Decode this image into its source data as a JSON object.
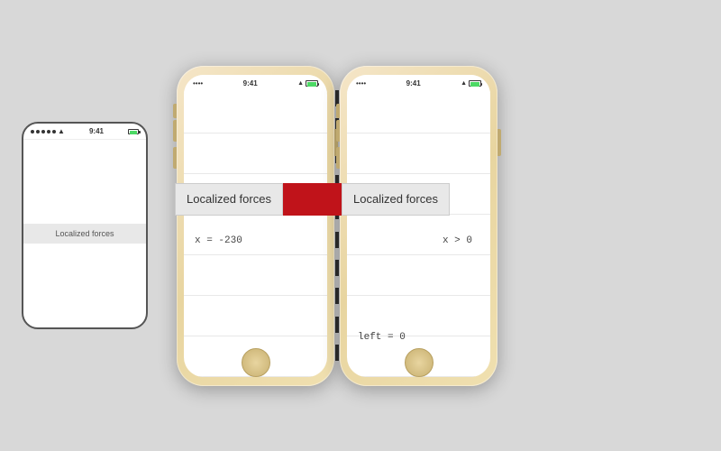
{
  "background": "#d8d8d8",
  "wireframe_phone": {
    "status_time": "9:41",
    "label": "Localized forces"
  },
  "phone_left": {
    "label": "Localized forces",
    "code": "x = -230",
    "lines_count": 6
  },
  "phone_right": {
    "label": "Localized forces",
    "code_top": "x > 0",
    "code_bottom": "left = 0",
    "lines_count": 6
  },
  "icons": {
    "signal": "••••",
    "wifi": "wifi",
    "battery": "battery"
  }
}
